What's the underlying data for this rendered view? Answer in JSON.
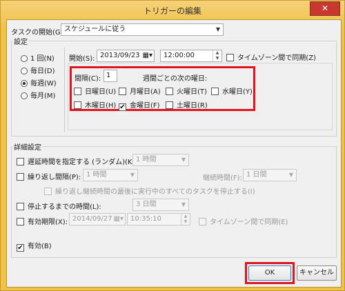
{
  "window": {
    "title": "トリガーの編集",
    "close_glyph": "✕"
  },
  "task_start": {
    "label": "タスクの開始(G):",
    "value": "スケジュールに従う"
  },
  "settings": {
    "title": "設定",
    "radios": [
      {
        "label": "1 回(N)",
        "checked": false
      },
      {
        "label": "毎日(D)",
        "checked": false
      },
      {
        "label": "毎週(W)",
        "checked": true
      },
      {
        "label": "毎月(M)",
        "checked": false
      }
    ],
    "start_label": "開始(S):",
    "start_date": "2013/09/23",
    "start_time": "12:00:00",
    "sync_timezone": {
      "label": "タイムゾーン間で同期(Z)",
      "checked": false
    },
    "interval_label": "間隔(C):",
    "interval_value": "1",
    "weekday_title": "週間ごとの次の曜日:",
    "weekdays": [
      {
        "label": "日曜日(U)",
        "checked": false
      },
      {
        "label": "月曜日(A)",
        "checked": false
      },
      {
        "label": "火曜日(T)",
        "checked": false
      },
      {
        "label": "水曜日(Y)",
        "checked": false
      },
      {
        "label": "木曜日(H)",
        "checked": false
      },
      {
        "label": "金曜日(F)",
        "checked": true
      },
      {
        "label": "土曜日(R)",
        "checked": false
      }
    ]
  },
  "advanced": {
    "title": "詳細設定",
    "delay": {
      "label": "遅延時間を指定する (ランダム)(K):",
      "value": "1 時間",
      "checked": false
    },
    "repeat": {
      "label": "繰り返し間隔(P):",
      "value": "1 時間",
      "checked": false,
      "duration_label": "継続時間(F):",
      "duration_value": "1 日間"
    },
    "stop_running": {
      "label": "繰り返し継続時間の最後に実行中のすべてのタスクを停止する(I)",
      "checked": false
    },
    "stop_after": {
      "label": "停止するまでの時間(L):",
      "value": "3 日間",
      "checked": false
    },
    "expire": {
      "label": "有効期限(X):",
      "date": "2014/09/27",
      "time": "10:35:10",
      "checked": false,
      "sync_label": "タイムゾーン間で同期(E)"
    },
    "enabled": {
      "label": "有効(B)",
      "checked": true
    }
  },
  "buttons": {
    "ok": "OK",
    "cancel": "キャンセル"
  },
  "colors": {
    "highlight": "#e0141e",
    "title_bar": "#f0c248",
    "close": "#c7392e"
  },
  "icons": {
    "close": "close-icon",
    "dropdown": "chevron-down-icon",
    "calendar": "calendar-icon",
    "check": "check-icon"
  }
}
